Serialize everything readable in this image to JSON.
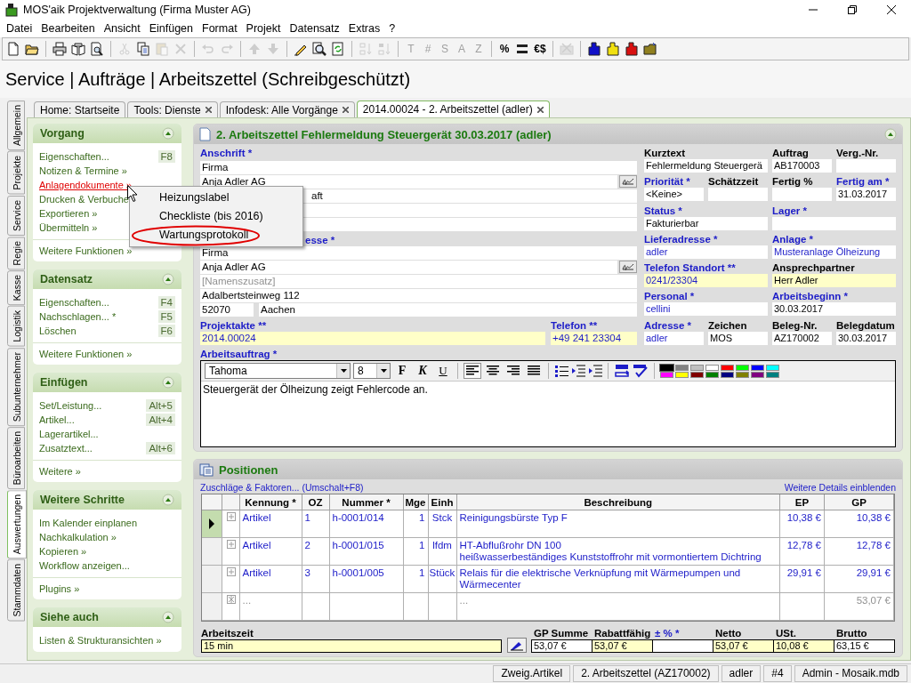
{
  "window": {
    "title": "MOS'aik Projektverwaltung (Firma Muster AG)"
  },
  "menu": [
    "Datei",
    "Bearbeiten",
    "Ansicht",
    "Einfügen",
    "Format",
    "Projekt",
    "Datensatz",
    "Extras",
    "?"
  ],
  "toolbar": [
    {
      "kind": "new",
      "disabled": false
    },
    {
      "kind": "open",
      "disabled": false
    },
    {
      "kind": "separator"
    },
    {
      "kind": "print",
      "disabled": false
    },
    {
      "kind": "book",
      "disabled": false
    },
    {
      "kind": "preview",
      "disabled": false
    },
    {
      "kind": "separator"
    },
    {
      "kind": "cut",
      "disabled": true
    },
    {
      "kind": "copy",
      "disabled": false
    },
    {
      "kind": "paste",
      "disabled": true
    },
    {
      "kind": "delete",
      "disabled": true
    },
    {
      "kind": "separator"
    },
    {
      "kind": "undo",
      "disabled": true
    },
    {
      "kind": "redo",
      "disabled": true
    },
    {
      "kind": "separator"
    },
    {
      "kind": "up",
      "disabled": true
    },
    {
      "kind": "down",
      "disabled": true
    },
    {
      "kind": "separator"
    },
    {
      "kind": "pencil",
      "disabled": false
    },
    {
      "kind": "find",
      "disabled": false
    },
    {
      "kind": "refresh",
      "disabled": false
    },
    {
      "kind": "separator"
    },
    {
      "kind": "sort_up",
      "disabled": true
    },
    {
      "kind": "sort_down",
      "disabled": true
    },
    {
      "kind": "separator"
    },
    {
      "kind": "glyph",
      "label": "T",
      "disabled": true
    },
    {
      "kind": "glyph",
      "label": "#",
      "disabled": true
    },
    {
      "kind": "glyph",
      "label": "S",
      "disabled": true
    },
    {
      "kind": "glyph",
      "label": "A",
      "disabled": true
    },
    {
      "kind": "glyph",
      "label": "Z",
      "disabled": true
    },
    {
      "kind": "separator"
    },
    {
      "kind": "glyph",
      "label": "%",
      "disabled": false
    },
    {
      "kind": "numbering",
      "disabled": false
    },
    {
      "kind": "glyph",
      "label": "€$",
      "disabled": false
    },
    {
      "kind": "separator"
    },
    {
      "kind": "tool",
      "disabled": true
    },
    {
      "kind": "separator"
    },
    {
      "kind": "figure",
      "color": "#1010c8"
    },
    {
      "kind": "figure",
      "color": "#f0e010"
    },
    {
      "kind": "figure",
      "color": "#d81010"
    },
    {
      "kind": "folder",
      "disabled": false
    }
  ],
  "heading": "Service | Aufträge | Arbeitszettel (Schreibgeschützt)",
  "side_tabs": [
    {
      "label": "Allgemein",
      "selected": false
    },
    {
      "label": "Projekte",
      "selected": false
    },
    {
      "label": "Service",
      "selected": false
    },
    {
      "label": "Regie",
      "selected": false
    },
    {
      "label": "Kasse",
      "selected": false
    },
    {
      "label": "Logistik",
      "selected": false
    },
    {
      "label": "Subunternehmer",
      "selected": false
    },
    {
      "label": "Büroarbeiten",
      "selected": false
    },
    {
      "label": "Auswertungen",
      "selected": true
    },
    {
      "label": "Stammdaten",
      "selected": false
    }
  ],
  "doc_tabs": [
    {
      "label": "Home: Startseite",
      "closable": false,
      "selected": false
    },
    {
      "label": "Tools: Dienste",
      "closable": true,
      "selected": false
    },
    {
      "label": "Infodesk: Alle Vorgänge",
      "closable": true,
      "selected": false
    },
    {
      "label": "2014.00024 - 2. Arbeitszettel (adler)",
      "closable": true,
      "selected": true
    }
  ],
  "sidebar": [
    {
      "title": "Vorgang",
      "items": [
        {
          "label": "Eigenschaften...",
          "shortcut": "F8",
          "hovered": false
        },
        {
          "label": "Notizen & Termine »",
          "hovered": false
        },
        {
          "label": "Anlagendokumente »",
          "hovered": true
        },
        {
          "label": "Drucken & Verbuche",
          "hovered": false
        },
        {
          "label": "Exportieren »",
          "hovered": false
        },
        {
          "label": "Übermitteln »",
          "hovered": false
        }
      ],
      "more": "Weitere Funktionen »"
    },
    {
      "title": "Datensatz",
      "items": [
        {
          "label": "Eigenschaften...",
          "shortcut": "F4",
          "hovered": false
        },
        {
          "label": "Nachschlagen... *",
          "shortcut": "F5",
          "hovered": false
        },
        {
          "label": "Löschen",
          "shortcut": "F6",
          "hovered": false
        }
      ],
      "more": "Weitere Funktionen »"
    },
    {
      "title": "Einfügen",
      "items": [
        {
          "label": "Set/Leistung...",
          "shortcut": "Alt+5",
          "hovered": false
        },
        {
          "label": "Artikel...",
          "shortcut": "Alt+4",
          "hovered": false
        },
        {
          "label": "Lagerartikel...",
          "hovered": false
        },
        {
          "label": "Zusatztext...",
          "shortcut": "Alt+6",
          "hovered": false
        }
      ],
      "more": "Weitere »"
    },
    {
      "title": "Weitere Schritte",
      "items": [
        {
          "label": "Im Kalender einplanen",
          "hovered": false
        },
        {
          "label": "Nachkalkulation »",
          "hovered": false
        },
        {
          "label": "Kopieren »",
          "hovered": false
        },
        {
          "label": "Workflow anzeigen...",
          "hovered": false
        }
      ],
      "more": "Plugins »"
    },
    {
      "title": "Siehe auch",
      "items": [
        {
          "label": "Listen & Strukturansichten »",
          "hovered": false
        }
      ]
    }
  ],
  "context_menu": [
    {
      "label": "Heizungslabel",
      "annotated": false
    },
    {
      "label": "Checkliste (bis 2016)",
      "annotated": false
    },
    {
      "label": "Wartungsprotokoll",
      "annotated": true
    }
  ],
  "form": {
    "title": "2. Arbeitszettel Fehlermeldung Steuergerät 30.03.2017 (adler)",
    "address_blocks": [
      {
        "label": "Anschrift *",
        "required": true,
        "covered": false,
        "fields": [
          {
            "value": "Firma"
          },
          {
            "value": "Anja Adler AG",
            "button": true
          },
          {
            "value": "aft",
            "covered": true
          },
          {
            "highlight": false
          },
          {
            "highlight": false
          }
        ]
      },
      {
        "label": "esse *",
        "required": true,
        "covered": true,
        "fields": [
          {
            "value": "Firma"
          },
          {
            "value": "Anja Adler AG",
            "button": true
          },
          {
            "placeholder": "[Namenszusatz]"
          },
          {
            "value": "Adalbertsteinweg 112"
          },
          {
            "value": "52070",
            "city": "Aachen"
          }
        ]
      }
    ],
    "bottom_left": [
      {
        "label": "Projektakte **",
        "required": true,
        "value": "2014.00024",
        "link": true,
        "highlight": true
      },
      {
        "label": "Telefon **",
        "required": true,
        "value": "+49 241 23304",
        "link": true,
        "highlight": true
      }
    ],
    "right": [
      {
        "label": "Kurztext",
        "required": false,
        "value": "Fehlermeldung Steuergerä",
        "link": false,
        "highlight": false
      },
      {
        "label": "Auftrag",
        "required": false,
        "value": "AB170003",
        "link": false,
        "highlight": false
      },
      {
        "label": "Verg.-Nr.",
        "required": false,
        "highlight": false
      },
      {
        "label": "Priorität *",
        "required": true,
        "value": "<Keine>",
        "link": false,
        "highlight": false
      },
      {
        "label": "Schätzzeit",
        "required": false,
        "highlight": false
      },
      {
        "label": "Fertig %",
        "required": false,
        "highlight": false
      },
      {
        "label": "Fertig am *",
        "required": true,
        "value": "31.03.2017",
        "link": false,
        "highlight": false
      },
      {
        "label": "Status *",
        "required": true,
        "value": "Fakturierbar",
        "link": false,
        "highlight": false
      },
      {
        "label": "Lager *",
        "required": true,
        "highlight": false
      },
      {
        "label": "Lieferadresse *",
        "required": true,
        "value": "adler",
        "link": true,
        "highlight": false
      },
      {
        "label": "Anlage *",
        "required": true,
        "value": "Musteranlage Ölheizung",
        "link": true,
        "highlight": false
      },
      {
        "label": "Telefon Standort **",
        "required": true,
        "value": "0241/23304",
        "link": true,
        "highlight": true
      },
      {
        "label": "Ansprechpartner",
        "required": false,
        "value": "Herr Adler",
        "link": false,
        "highlight": true
      },
      {
        "label": "Personal *",
        "required": true,
        "value": "cellini",
        "link": true,
        "highlight": false
      },
      {
        "label": "Arbeitsbeginn *",
        "required": true,
        "value": "30.03.2017",
        "link": false,
        "highlight": false
      },
      {
        "label": "Adresse *",
        "required": true,
        "value": "adler",
        "link": true,
        "highlight": false
      },
      {
        "label": "Zeichen",
        "required": false,
        "value": "MOS",
        "link": false,
        "highlight": false
      },
      {
        "label": "Beleg-Nr.",
        "required": false,
        "value": "AZ170002",
        "link": false,
        "highlight": false
      },
      {
        "label": "Belegdatum",
        "required": false,
        "value": "30.03.2017",
        "link": false,
        "highlight": false
      }
    ],
    "work_order": {
      "label": "Arbeitsauftrag *",
      "required": true,
      "font": "Tahoma",
      "size": "8",
      "format_buttons": [
        {
          "label": "F",
          "kind": "bold"
        },
        {
          "label": "K",
          "kind": "italic"
        },
        {
          "label": "U",
          "kind": "underline"
        }
      ],
      "alignments": [
        {
          "kind": "left",
          "selected": true
        },
        {
          "kind": "center",
          "selected": false
        },
        {
          "kind": "right",
          "selected": false
        },
        {
          "kind": "justify",
          "selected": false
        }
      ],
      "palette": [
        {
          "color": "#000000",
          "selected": true
        },
        {
          "color": "#808080",
          "selected": false
        },
        {
          "color": "#c0c0c0",
          "selected": false
        },
        {
          "color": "#ffffff",
          "selected": false
        },
        {
          "color": "#ff0000",
          "selected": false
        },
        {
          "color": "#00ff00",
          "selected": false
        },
        {
          "color": "#0000ff",
          "selected": false
        },
        {
          "color": "#00ffff",
          "selected": false
        },
        {
          "color": "#ff00ff",
          "selected": false
        },
        {
          "color": "#ffff00",
          "selected": false
        },
        {
          "color": "#800000",
          "selected": false
        },
        {
          "color": "#008000",
          "selected": false
        },
        {
          "color": "#000080",
          "selected": false
        },
        {
          "color": "#808000",
          "selected": false
        },
        {
          "color": "#800080",
          "selected": false
        },
        {
          "color": "#008080",
          "selected": false
        }
      ],
      "text": "Steuergerät der Ölheizung zeigt Fehlercode an."
    }
  },
  "positions": {
    "title": "Positionen",
    "left_link": "Zuschläge & Faktoren... (Umschalt+F8)",
    "right_link": "Weitere Details einblenden",
    "columns": [
      "Kennung *",
      "OZ",
      "Nummer *",
      "Mge",
      "Einh",
      "Beschreibung",
      "EP",
      "GP"
    ],
    "rows": [
      {
        "kind": "item",
        "selected": true,
        "cells": [
          "Artikel",
          "1",
          "h-0001/014",
          "1",
          "Stck",
          "Reinigungsbürste Typ F",
          "10,38 €",
          "10,38 €"
        ]
      },
      {
        "kind": "item",
        "selected": false,
        "cells": [
          "Artikel",
          "2",
          "h-0001/015",
          "1",
          "lfdm",
          "HT-Abflußrohr DN 100\nheißwasserbeständiges Kunststoffrohr mit vormontiertem Dichtring",
          "12,78 €",
          "12,78 €"
        ]
      },
      {
        "kind": "item",
        "selected": false,
        "cells": [
          "Artikel",
          "3",
          "h-0001/005",
          "1",
          "Stück",
          "Relais für die elektrische Verknüpfung mit Wärmepumpen und\nWärmecenter",
          "29,91 €",
          "29,91 €"
        ]
      },
      {
        "kind": "new",
        "selected": false,
        "placeholder": "...",
        "description_placeholder": "...",
        "total": "53,07 €"
      }
    ],
    "work_time": {
      "label": "Arbeitszeit",
      "value": "15 min"
    },
    "totals": [
      {
        "label": "GP Summe",
        "required": false,
        "value": "53,07 €",
        "highlight": false
      },
      {
        "label": "Rabattfähig",
        "required": false,
        "value": "53,07 €",
        "highlight": true
      },
      {
        "label": "± % *",
        "required": true,
        "highlight": false
      },
      {
        "label": "Netto",
        "required": false,
        "value": "53,07 €",
        "highlight": true
      },
      {
        "label": "USt.",
        "required": false,
        "value": "10,08 €",
        "highlight": true
      },
      {
        "label": "Brutto",
        "required": false,
        "value": "63,15 €",
        "highlight": false
      }
    ]
  },
  "status_bar": [
    "Zweig.Artikel",
    "2. Arbeitszettel (AZ170002)",
    "adler",
    "#4",
    "Admin - Mosaik.mdb"
  ]
}
